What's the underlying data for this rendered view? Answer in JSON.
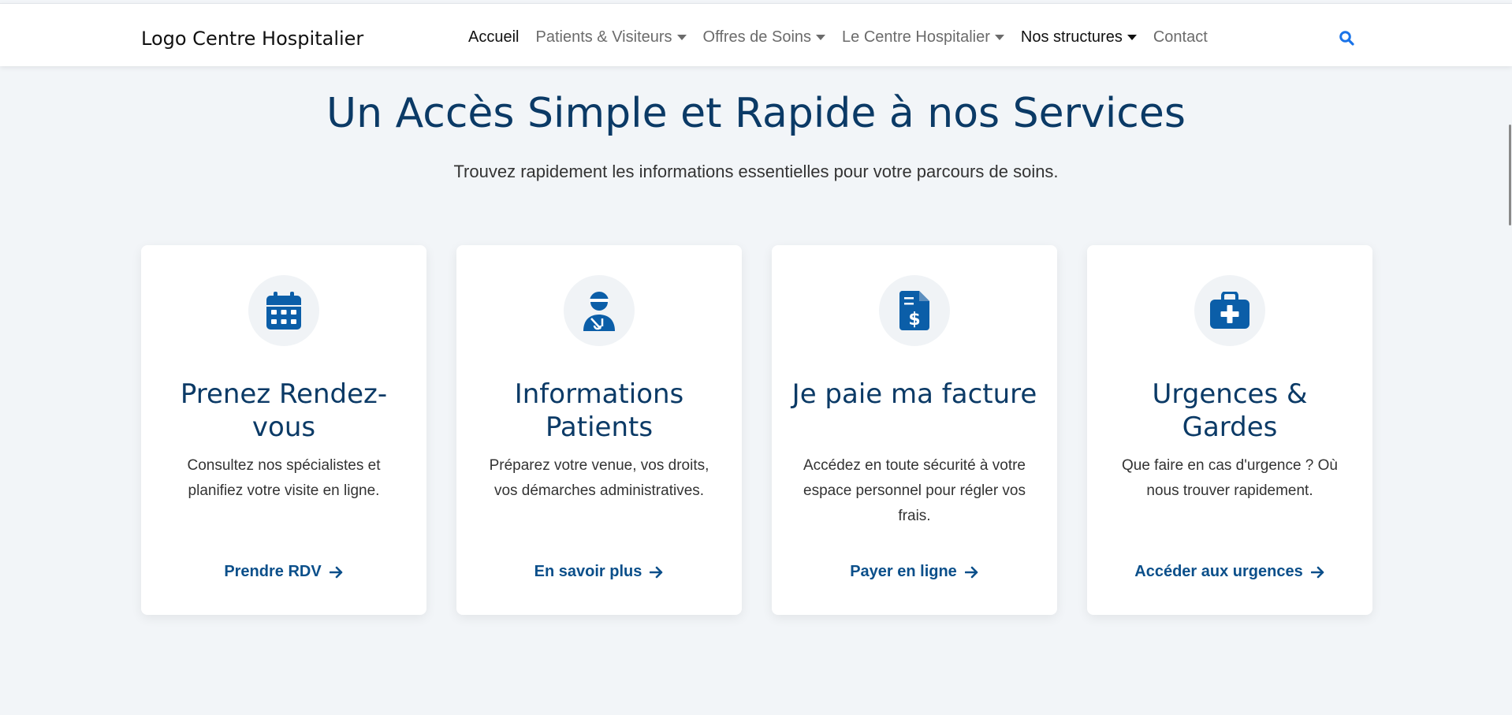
{
  "header": {
    "brand": "Logo Centre Hospitalier",
    "nav": [
      {
        "label": "Accueil",
        "dropdown": false
      },
      {
        "label": "Patients & Visiteurs",
        "dropdown": true
      },
      {
        "label": "Offres de Soins",
        "dropdown": true
      },
      {
        "label": "Le Centre Hospitalier",
        "dropdown": true
      },
      {
        "label": "Nos structures",
        "dropdown": true
      },
      {
        "label": "Contact",
        "dropdown": false
      }
    ],
    "search_icon": "search-icon"
  },
  "hero": {
    "title": "Un Accès Simple et Rapide à nos Services",
    "subtitle": "Trouvez rapidement les informations essentielles pour votre parcours de soins."
  },
  "cards": [
    {
      "icon": "calendar-icon",
      "title": "Prenez Rendez-vous",
      "text": "Consultez nos spécialistes et planifiez votre visite en ligne.",
      "link": "Prendre RDV"
    },
    {
      "icon": "patient-icon",
      "title": "Informations Patients",
      "text": "Préparez votre venue, vos droits, vos démarches administratives.",
      "link": "En savoir plus"
    },
    {
      "icon": "invoice-icon",
      "title": "Je paie ma facture",
      "text": "Accédez en toute sécurité à votre espace personnel pour régler vos frais.",
      "link": "Payer en ligne"
    },
    {
      "icon": "medical-kit-icon",
      "title": "Urgences & Gardes",
      "text": "Que faire en cas d'urgence ? Où nous trouver rapidement.",
      "link": "Accéder aux urgences"
    }
  ],
  "colors": {
    "primary": "#0b3a66",
    "accent": "#0b5ea8",
    "link": "#0b4f8a",
    "search": "#1a73e8",
    "background": "#f2f5f8"
  }
}
